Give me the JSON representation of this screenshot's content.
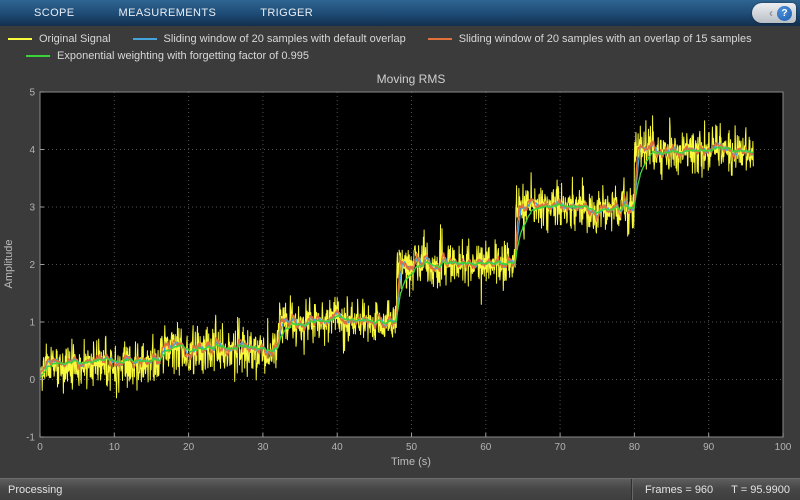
{
  "toolbar": {
    "tabs": [
      "SCOPE",
      "MEASUREMENTS",
      "TRIGGER"
    ],
    "help_label": "?"
  },
  "chart_data": {
    "type": "line",
    "title": "Moving RMS",
    "xlabel": "Time (s)",
    "ylabel": "Amplitude",
    "xlim": [
      0,
      100
    ],
    "ylim": [
      -1,
      5
    ],
    "xticks": [
      0,
      10,
      20,
      30,
      40,
      50,
      60,
      70,
      80,
      90,
      100
    ],
    "yticks": [
      -1,
      0,
      1,
      2,
      3,
      4,
      5
    ],
    "grid": true,
    "legend_position": "top-left",
    "plot_bg": "#000000",
    "grid_color": "#4f4f4f",
    "axis_color": "#8a8a8a",
    "signal": {
      "kind": "noisy staircase",
      "step_times": [
        0,
        16,
        32,
        48,
        64,
        80
      ],
      "step_levels": [
        0.25,
        0.5,
        1,
        2,
        3,
        4
      ],
      "end_time": 96,
      "noise_std": 0.2,
      "sample_dt": 0.05,
      "seed": 11
    },
    "segment_rms": [
      0.32,
      0.54,
      1.02,
      2.01,
      3.01,
      4.0
    ],
    "series": [
      {
        "name": "Original Signal",
        "color": "#f8f83c",
        "role": "source"
      },
      {
        "name": "Sliding window of 20 samples with default overlap",
        "color": "#45a3dd",
        "role": "moving-rms",
        "window_samples": 20,
        "overlap": "default",
        "render_window_s": 0.8
      },
      {
        "name": "Sliding window of 20 samples with an overlap of 15 samples",
        "color": "#e2703a",
        "role": "moving-rms",
        "window_samples": 20,
        "overlap": 15,
        "render_window_s": 0.5
      },
      {
        "name": "Exponential weighting with forgetting factor of 0.995",
        "color": "#3bd43b",
        "role": "exp-rms",
        "forgetting_factor": 0.995,
        "render_tau_s": 1.2
      }
    ]
  },
  "status": {
    "left": "Processing",
    "frames": "Frames = 960",
    "time": "T = 95.9900"
  }
}
